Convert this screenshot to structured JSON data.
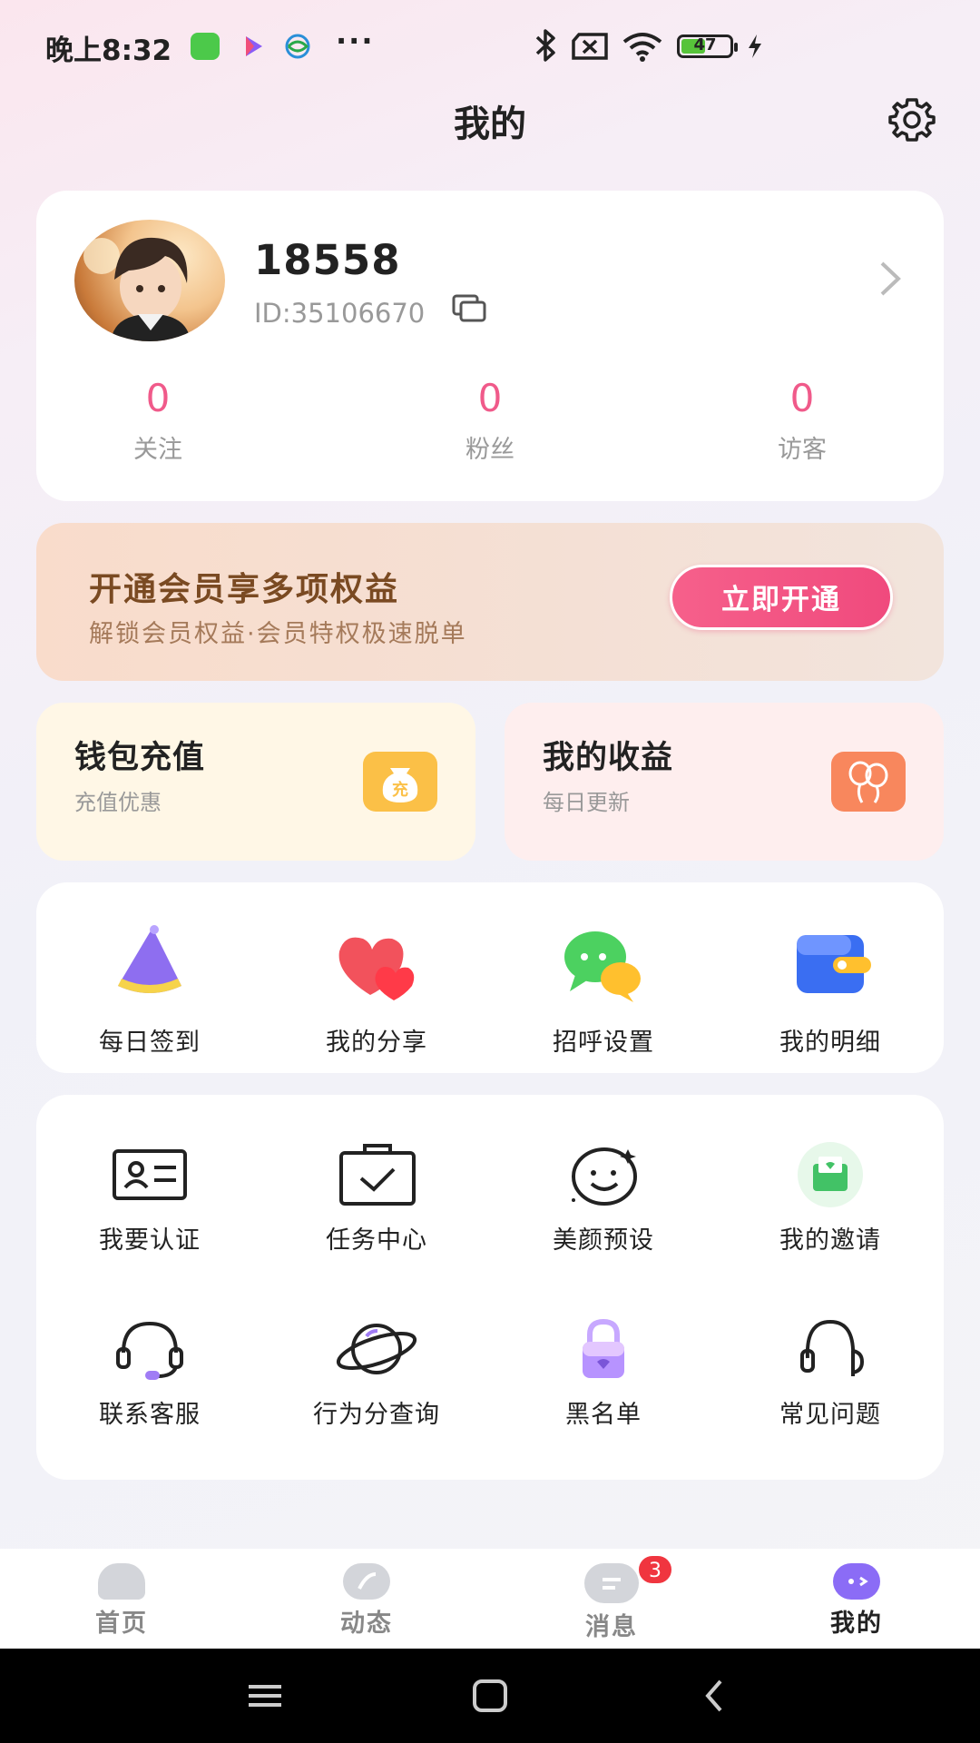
{
  "status_bar": {
    "time": "晚上8:32",
    "dots": "···",
    "battery": "47"
  },
  "header": {
    "title": "我的"
  },
  "profile": {
    "username": "18558",
    "user_id": "ID:35106670",
    "stats": [
      {
        "value": "0",
        "label": "关注"
      },
      {
        "value": "0",
        "label": "粉丝"
      },
      {
        "value": "0",
        "label": "访客"
      }
    ]
  },
  "vip": {
    "title": "开通会员享多项权益",
    "subtitle": "解锁会员权益·会员特权极速脱单",
    "button": "立即开通"
  },
  "wallet": {
    "title": "钱包充值",
    "subtitle": "充值优惠",
    "icon_text": "充"
  },
  "income": {
    "title": "我的收益",
    "subtitle": "每日更新"
  },
  "quick": [
    {
      "label": "每日签到",
      "icon": "wizard-hat-icon"
    },
    {
      "label": "我的分享",
      "icon": "hearts-icon"
    },
    {
      "label": "招呼设置",
      "icon": "chat-bubbles-icon"
    },
    {
      "label": "我的明细",
      "icon": "wallet-icon"
    }
  ],
  "tools": [
    {
      "label": "我要认证",
      "icon": "id-card-icon"
    },
    {
      "label": "任务中心",
      "icon": "clipboard-check-icon"
    },
    {
      "label": "美颜预设",
      "icon": "smiley-face-icon"
    },
    {
      "label": "我的邀请",
      "icon": "invitation-envelope-icon"
    },
    {
      "label": "联系客服",
      "icon": "headset-icon"
    },
    {
      "label": "行为分查询",
      "icon": "planet-icon"
    },
    {
      "label": "黑名单",
      "icon": "padlock-icon"
    },
    {
      "label": "常见问题",
      "icon": "headphones-icon"
    }
  ],
  "nav": {
    "items": [
      {
        "label": "首页",
        "icon": "home-icon"
      },
      {
        "label": "动态",
        "icon": "feed-icon"
      },
      {
        "label": "消息",
        "icon": "message-icon"
      },
      {
        "label": "我的",
        "icon": "profile-face-icon"
      }
    ],
    "message_badge": "3",
    "active_index": 3
  },
  "colors": {
    "accent_pink": "#f05a8a",
    "vip_button": "#f04a7d",
    "active_nav": "#8b6cf6",
    "badge": "#f0353f"
  }
}
